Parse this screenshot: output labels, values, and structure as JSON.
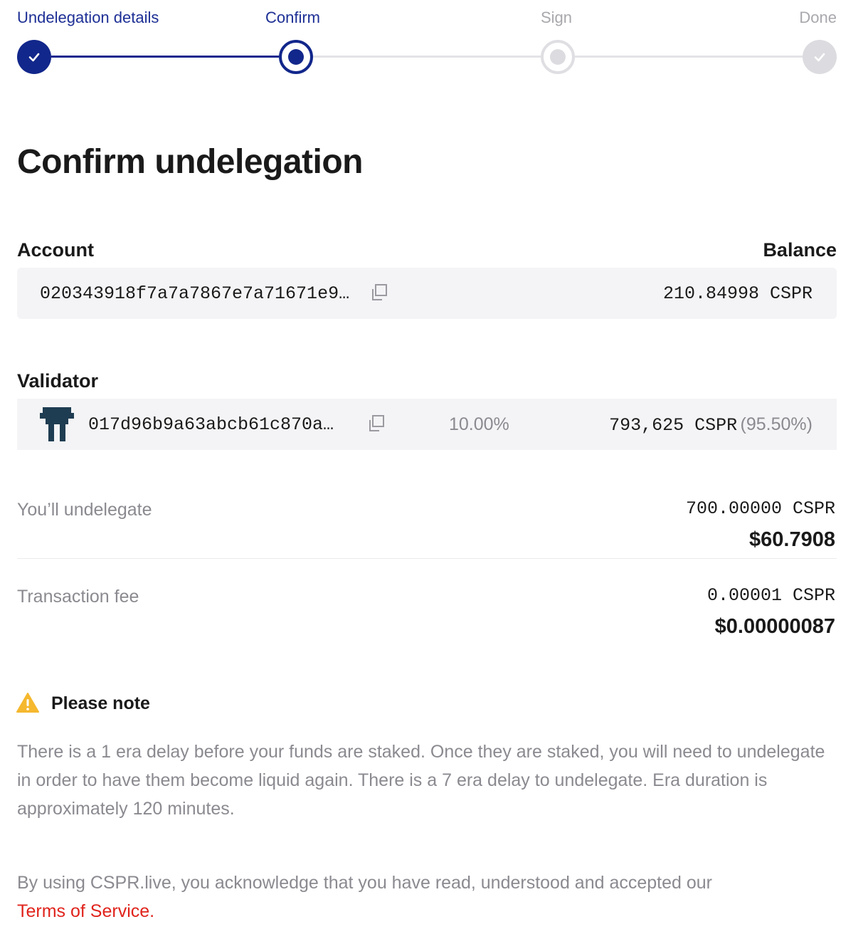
{
  "stepper": {
    "steps": [
      {
        "label": "Undelegation details",
        "state": "completed"
      },
      {
        "label": "Confirm",
        "state": "current"
      },
      {
        "label": "Sign",
        "state": "pending"
      },
      {
        "label": "Done",
        "state": "future"
      }
    ]
  },
  "page": {
    "title": "Confirm undelegation"
  },
  "account": {
    "label": "Account",
    "balance_label": "Balance",
    "key": "020343918f7a7a7867e7a71671e9…",
    "balance": "210.84998 CSPR"
  },
  "validator": {
    "label": "Validator",
    "key": "017d96b9a63abcb61c870a…",
    "fee": "10.00%",
    "stake": "793,625 CSPR",
    "stake_share": "(95.50%)"
  },
  "undelegate": {
    "label": "You’ll undelegate",
    "amount": "700.00000 CSPR",
    "fiat": "$60.7908"
  },
  "fee": {
    "label": "Transaction fee",
    "amount": "0.00001 CSPR",
    "fiat": "$0.00000087"
  },
  "note": {
    "title": "Please note",
    "text": "There is a 1 era delay before your funds are staked. Once they are staked, you will need to undelegate in order to have them become liquid again. There is a 7 era delay to undelegate. Era duration is approximately 120 minutes."
  },
  "legal": {
    "text": "By using CSPR.live, you acknowledge that you have read, understood and accepted our",
    "link": "Terms of Service."
  },
  "colors": {
    "primary": "#12278b",
    "muted": "#8a8a90",
    "link": "#e0241c",
    "warning": "#f5b82e"
  },
  "icons": [
    "check-icon",
    "copy-icon",
    "warning-icon",
    "validator-avatar"
  ]
}
